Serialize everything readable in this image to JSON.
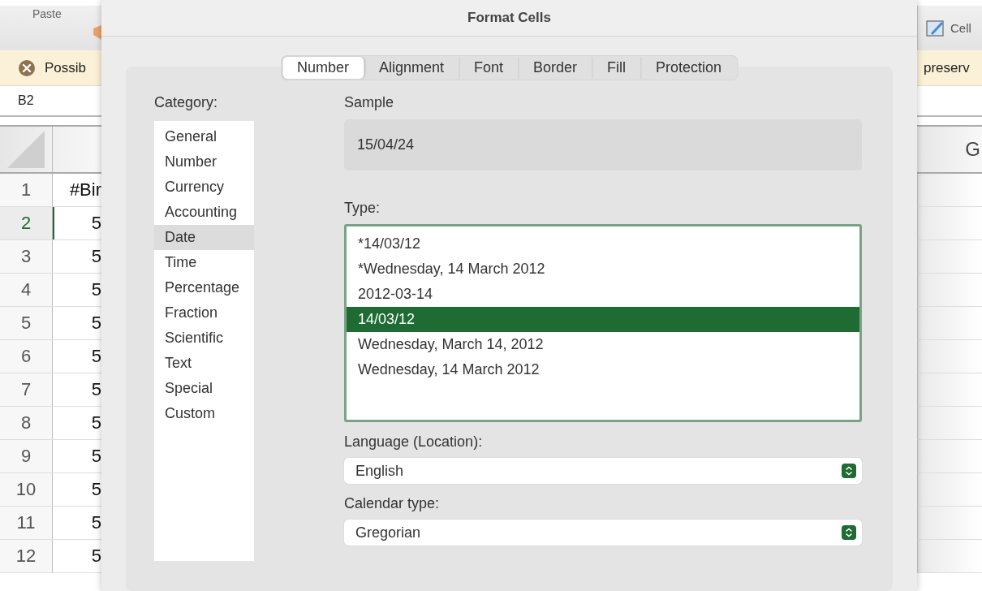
{
  "spreadsheet": {
    "left_toolbar_label": "Paste",
    "right_toolbar_label": "Cell",
    "warning_left": "Possib",
    "warning_right": "preserv",
    "name_box": "B2",
    "right_column_header": "G",
    "rows": [
      {
        "number": "1",
        "cell": "#Bir",
        "selected": false
      },
      {
        "number": "2",
        "cell": "5",
        "selected": true
      },
      {
        "number": "3",
        "cell": "5",
        "selected": false
      },
      {
        "number": "4",
        "cell": "5",
        "selected": false
      },
      {
        "number": "5",
        "cell": "5",
        "selected": false
      },
      {
        "number": "6",
        "cell": "5",
        "selected": false
      },
      {
        "number": "7",
        "cell": "5",
        "selected": false
      },
      {
        "number": "8",
        "cell": "5",
        "selected": false
      },
      {
        "number": "9",
        "cell": "5",
        "selected": false
      },
      {
        "number": "10",
        "cell": "5",
        "selected": false
      },
      {
        "number": "11",
        "cell": "5",
        "selected": false
      },
      {
        "number": "12",
        "cell": "5",
        "selected": false
      }
    ]
  },
  "dialog": {
    "title": "Format Cells",
    "tabs": [
      {
        "label": "Number",
        "selected": true
      },
      {
        "label": "Alignment",
        "selected": false
      },
      {
        "label": "Font",
        "selected": false
      },
      {
        "label": "Border",
        "selected": false
      },
      {
        "label": "Fill",
        "selected": false
      },
      {
        "label": "Protection",
        "selected": false
      }
    ],
    "category": {
      "label": "Category:",
      "items": [
        {
          "label": "General",
          "selected": false
        },
        {
          "label": "Number",
          "selected": false
        },
        {
          "label": "Currency",
          "selected": false
        },
        {
          "label": "Accounting",
          "selected": false
        },
        {
          "label": "Date",
          "selected": true
        },
        {
          "label": "Time",
          "selected": false
        },
        {
          "label": "Percentage",
          "selected": false
        },
        {
          "label": "Fraction",
          "selected": false
        },
        {
          "label": "Scientific",
          "selected": false
        },
        {
          "label": "Text",
          "selected": false
        },
        {
          "label": "Special",
          "selected": false
        },
        {
          "label": "Custom",
          "selected": false
        }
      ]
    },
    "sample": {
      "label": "Sample",
      "value": "15/04/24"
    },
    "type": {
      "label": "Type:",
      "items": [
        {
          "label": "*14/03/12",
          "selected": false
        },
        {
          "label": "*Wednesday, 14 March 2012",
          "selected": false
        },
        {
          "label": "2012-03-14",
          "selected": false
        },
        {
          "label": "14/03/12",
          "selected": true
        },
        {
          "label": "Wednesday, March 14, 2012",
          "selected": false
        },
        {
          "label": "Wednesday, 14 March 2012",
          "selected": false
        }
      ]
    },
    "language": {
      "label": "Language (Location):",
      "value": "English"
    },
    "calendar": {
      "label": "Calendar type:",
      "value": "Gregorian"
    }
  }
}
